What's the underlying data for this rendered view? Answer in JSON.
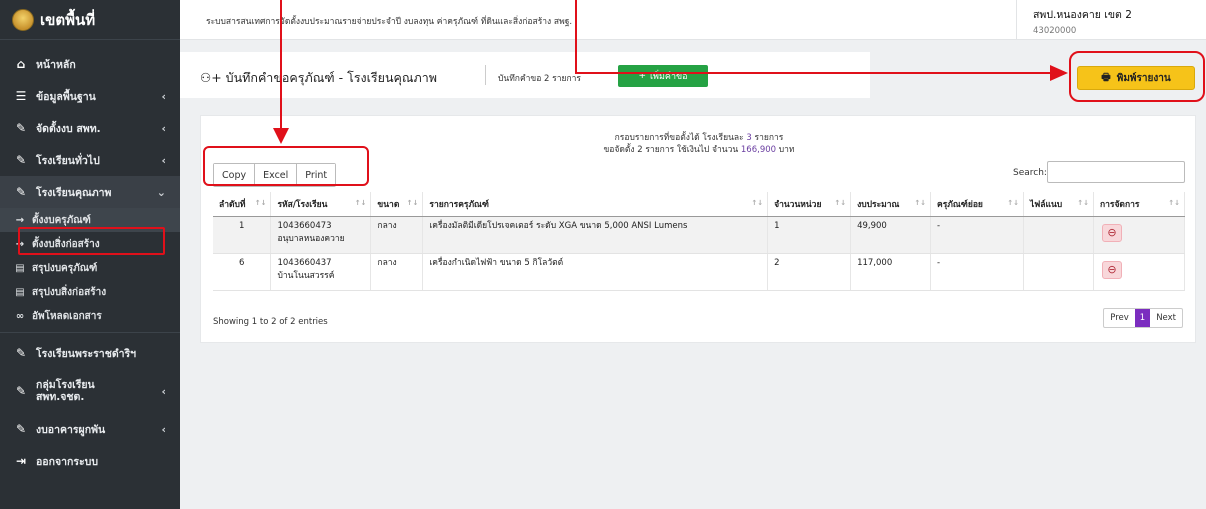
{
  "sidebar": {
    "brand": "เขตพื้นที่",
    "items": [
      {
        "label": "หน้าหลัก"
      },
      {
        "label": "ข้อมูลพื้นฐาน"
      },
      {
        "label": "จัดตั้งงบ สพท."
      },
      {
        "label": "โรงเรียนทั่วไป"
      },
      {
        "label": "โรงเรียนคุณภาพ"
      }
    ],
    "sub_items": [
      {
        "label": "ตั้งงบครุภัณฑ์"
      },
      {
        "label": "ตั้งงบสิ่งก่อสร้าง"
      },
      {
        "label": "สรุปงบครุภัณฑ์"
      },
      {
        "label": "สรุปงบสิ่งก่อสร้าง"
      },
      {
        "label": "อัพโหลดเอกสาร"
      }
    ],
    "more_items": [
      {
        "label": "โรงเรียนพระราชดำริฯ"
      },
      {
        "label": "กลุ่มโรงเรียน",
        "label2": "สพท.จชต."
      },
      {
        "label": "งบอาคารผูกพัน"
      },
      {
        "label": "ออกจากระบบ"
      }
    ]
  },
  "topbar": {
    "system_title": "ระบบสารสนเทศการจัดตั้งงบประมาณรายจ่ายประจำปี งบลงทุน ค่าครุภัณฑ์ ที่ดินและสิ่งก่อสร้าง สพฐ.",
    "user_name": "สพป.หนองคาย เขต 2",
    "user_code": "43020000"
  },
  "page": {
    "title": "บันทึกคำขอครุภัณฑ์ - โรงเรียนคุณภาพ",
    "request_count": "บันทึกคำขอ 2 รายการ",
    "add_button": "เพิ่มคำขอ",
    "print_button": "พิมพ์รายงาน"
  },
  "summary": {
    "line1_prefix": "กรอบรายการที่ขอตั้งได้ โรงเรียนละ",
    "line1_value": "3",
    "line1_suffix": "รายการ",
    "line2_prefix": "ขอจัดตั้ง 2 รายการ ใช้เงินไป จำนวน",
    "line2_value": "166,900",
    "line2_suffix": "บาท"
  },
  "table_tools": {
    "buttons": [
      "Copy",
      "Excel",
      "Print"
    ],
    "search_label": "Search:",
    "search_value": ""
  },
  "table": {
    "columns": [
      "ลำดับที่",
      "รหัส/โรงเรียน",
      "ขนาด",
      "รายการครุภัณฑ์",
      "จำนวนหน่วย",
      "งบประมาณ",
      "ครุภัณฑ์ย่อย",
      "ไฟล์แนบ",
      "การจัดการ"
    ],
    "rows": [
      {
        "no": "1",
        "code": "1043660473",
        "school": "อนุบาลหนองควาย",
        "size": "กลาง",
        "item": "เครื่องมัลติมีเดียโปรเจคเตอร์ ระดับ XGA ขนาด 5,000 ANSI Lumens",
        "qty": "1",
        "budget": "49,900",
        "sub": "-",
        "file": ""
      },
      {
        "no": "6",
        "code": "1043660437",
        "school": "บ้านโนนสวรรค์",
        "size": "กลาง",
        "item": "เครื่องกำเนิดไฟฟ้า ขนาด 5 กิโลวัตต์",
        "qty": "2",
        "budget": "117,000",
        "sub": "-",
        "file": ""
      }
    ]
  },
  "footer": {
    "info": "Showing 1 to 2 of 2 entries",
    "prev": "Prev",
    "page": "1",
    "next": "Next"
  },
  "colors": {
    "sidebar_bg": "#2b3035",
    "add_button": "#25a244",
    "print_button": "#f6c319",
    "annotation": "#e0101a",
    "pager_active": "#7b2dbf"
  }
}
